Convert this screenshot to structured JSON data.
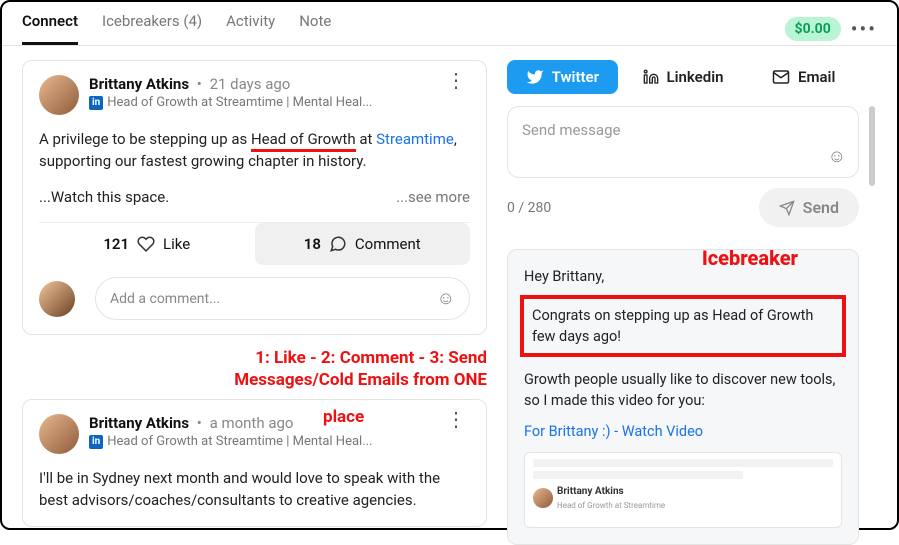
{
  "topbar": {
    "tabs": [
      "Connect",
      "Icebreakers (4)",
      "Activity",
      "Note"
    ],
    "active_tab": 0,
    "balance": "$0.00"
  },
  "posts": [
    {
      "name": "Brittany Atkins",
      "time": "21 days ago",
      "subtitle": "Head of Growth at Streamtime | Mental Heal...",
      "body_prefix": "A privilege to be stepping up as ",
      "body_highlight": "Head of Growth",
      "body_mid": " at ",
      "body_link": "Streamtime",
      "body_suffix": ", supporting our fastest growing chapter in history.",
      "body_line2": "...Watch this space.",
      "see_more": "...see more",
      "like_count": "121",
      "like_label": "Like",
      "comment_count": "18",
      "comment_label": "Comment",
      "comment_placeholder": "Add a comment..."
    },
    {
      "name": "Brittany Atkins",
      "time": "a month ago",
      "subtitle": "Head of Growth at Streamtime | Mental Heal...",
      "body": "I'll be in Sydney next month and would love to speak with the best advisors/coaches/consultants to creative agencies."
    }
  ],
  "annotations": {
    "steps_line1": "1: Like - 2: Comment - 3: Send",
    "steps_line2": "Messages/Cold Emails from ONE",
    "steps_line3": "place",
    "icebreaker_label": "Icebreaker"
  },
  "channels": {
    "twitter": "Twitter",
    "linkedin": "Linkedin",
    "email": "Email"
  },
  "compose": {
    "placeholder": "Send message",
    "counter": "0 / 280",
    "send": "Send"
  },
  "message": {
    "greeting": "Hey Brittany,",
    "highlight": "Congrats on stepping up as Head of Growth few days ago!",
    "body2": "Growth people usually like to discover new tools, so I made this video for you:",
    "link": "For Brittany :) - Watch Video",
    "preview_name": "Brittany Atkins",
    "preview_sub": "Head of Growth at Streamtime"
  }
}
